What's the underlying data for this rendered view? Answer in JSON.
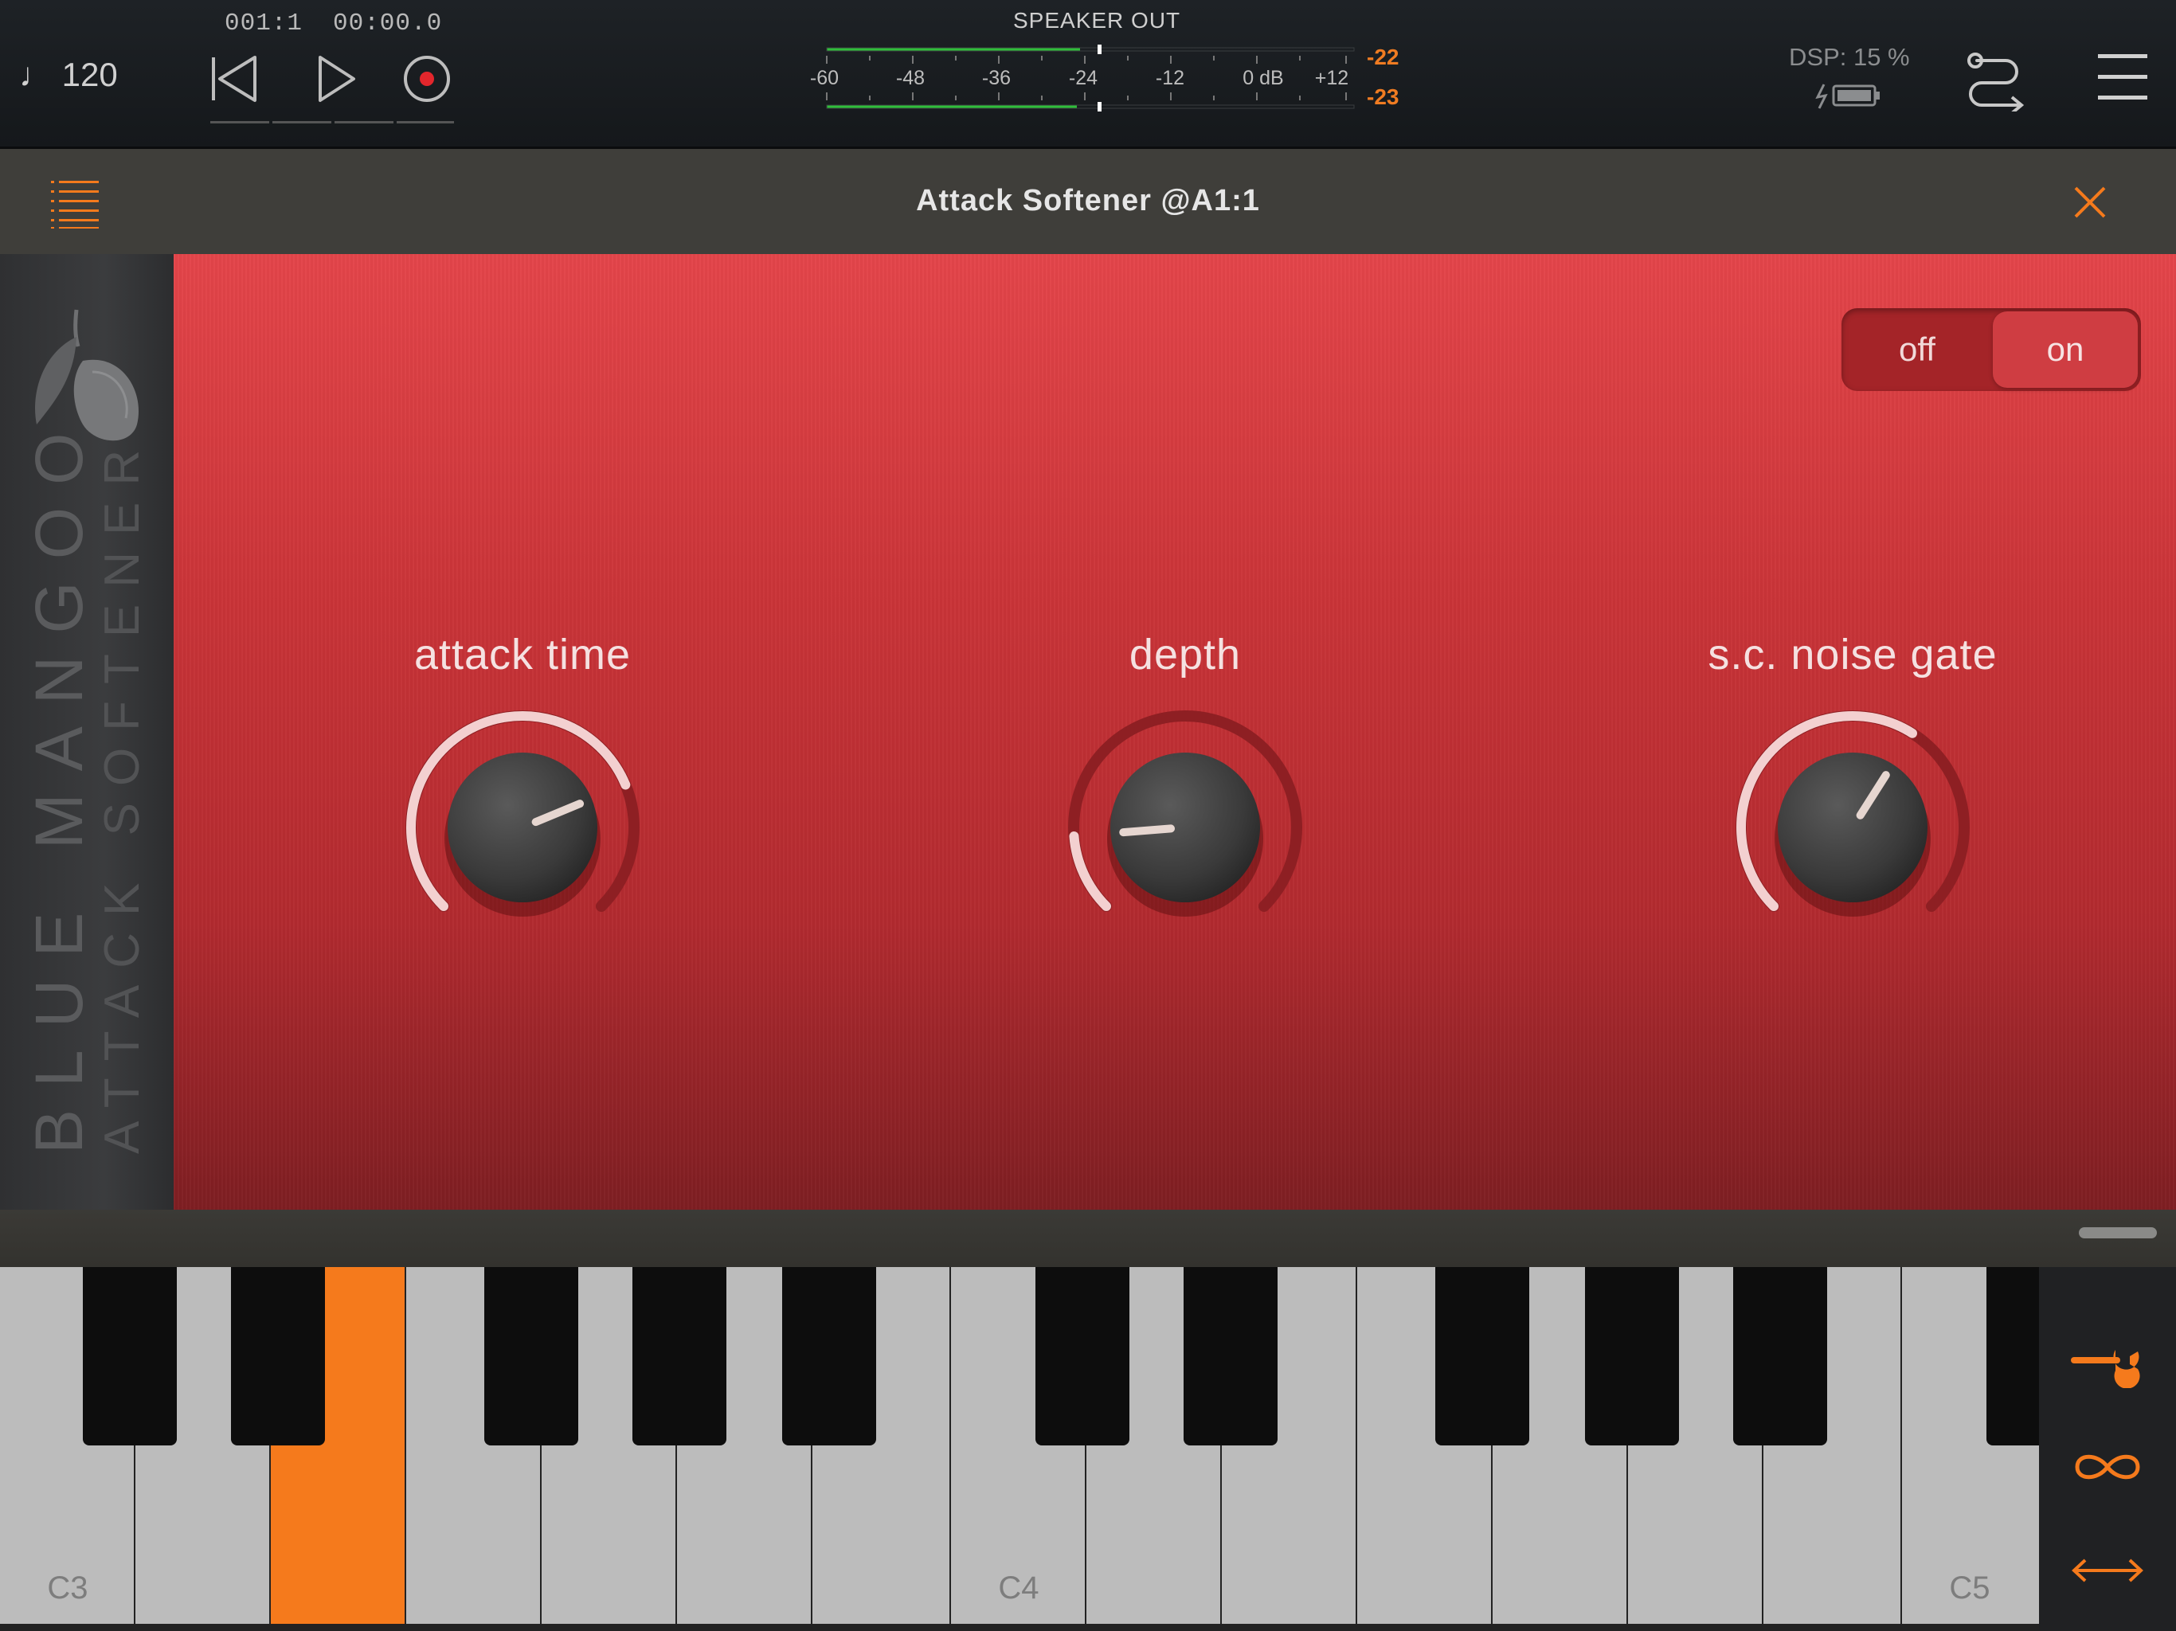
{
  "transport": {
    "tempo": "♩ 120",
    "bars": "001:1",
    "time": "00:00.0"
  },
  "meter": {
    "title": "SPEAKER OUT",
    "scale": [
      "-60",
      "-48",
      "-36",
      "-24",
      "-12",
      "0 dB",
      "+12"
    ],
    "peak_left": "-22",
    "peak_right": "-23"
  },
  "status": {
    "dsp": "DSP: 15 %"
  },
  "plugin": {
    "title": "Attack Softener @A1:1",
    "brand_name": "BLUE MANGOO",
    "brand_product": "ATTACK SOFTENER",
    "switch_off": "off",
    "switch_on": "on",
    "knobs": [
      {
        "label": "attack time",
        "value": 0.75
      },
      {
        "label": "depth",
        "value": 0.15
      },
      {
        "label": "s.c. noise gate",
        "value": 0.62
      }
    ]
  },
  "keyboard": {
    "labels": [
      "C3",
      "C4",
      "C5"
    ],
    "pressed_note": "E3"
  },
  "colors": {
    "accent": "#f57a1c",
    "panel_red": "#cb3438",
    "meter_green": "#2fbf3a",
    "peak_orange": "#f07c22"
  },
  "icons": {
    "tools": [
      "wrench-icon",
      "loop-icon",
      "resize-arrows-icon"
    ]
  }
}
